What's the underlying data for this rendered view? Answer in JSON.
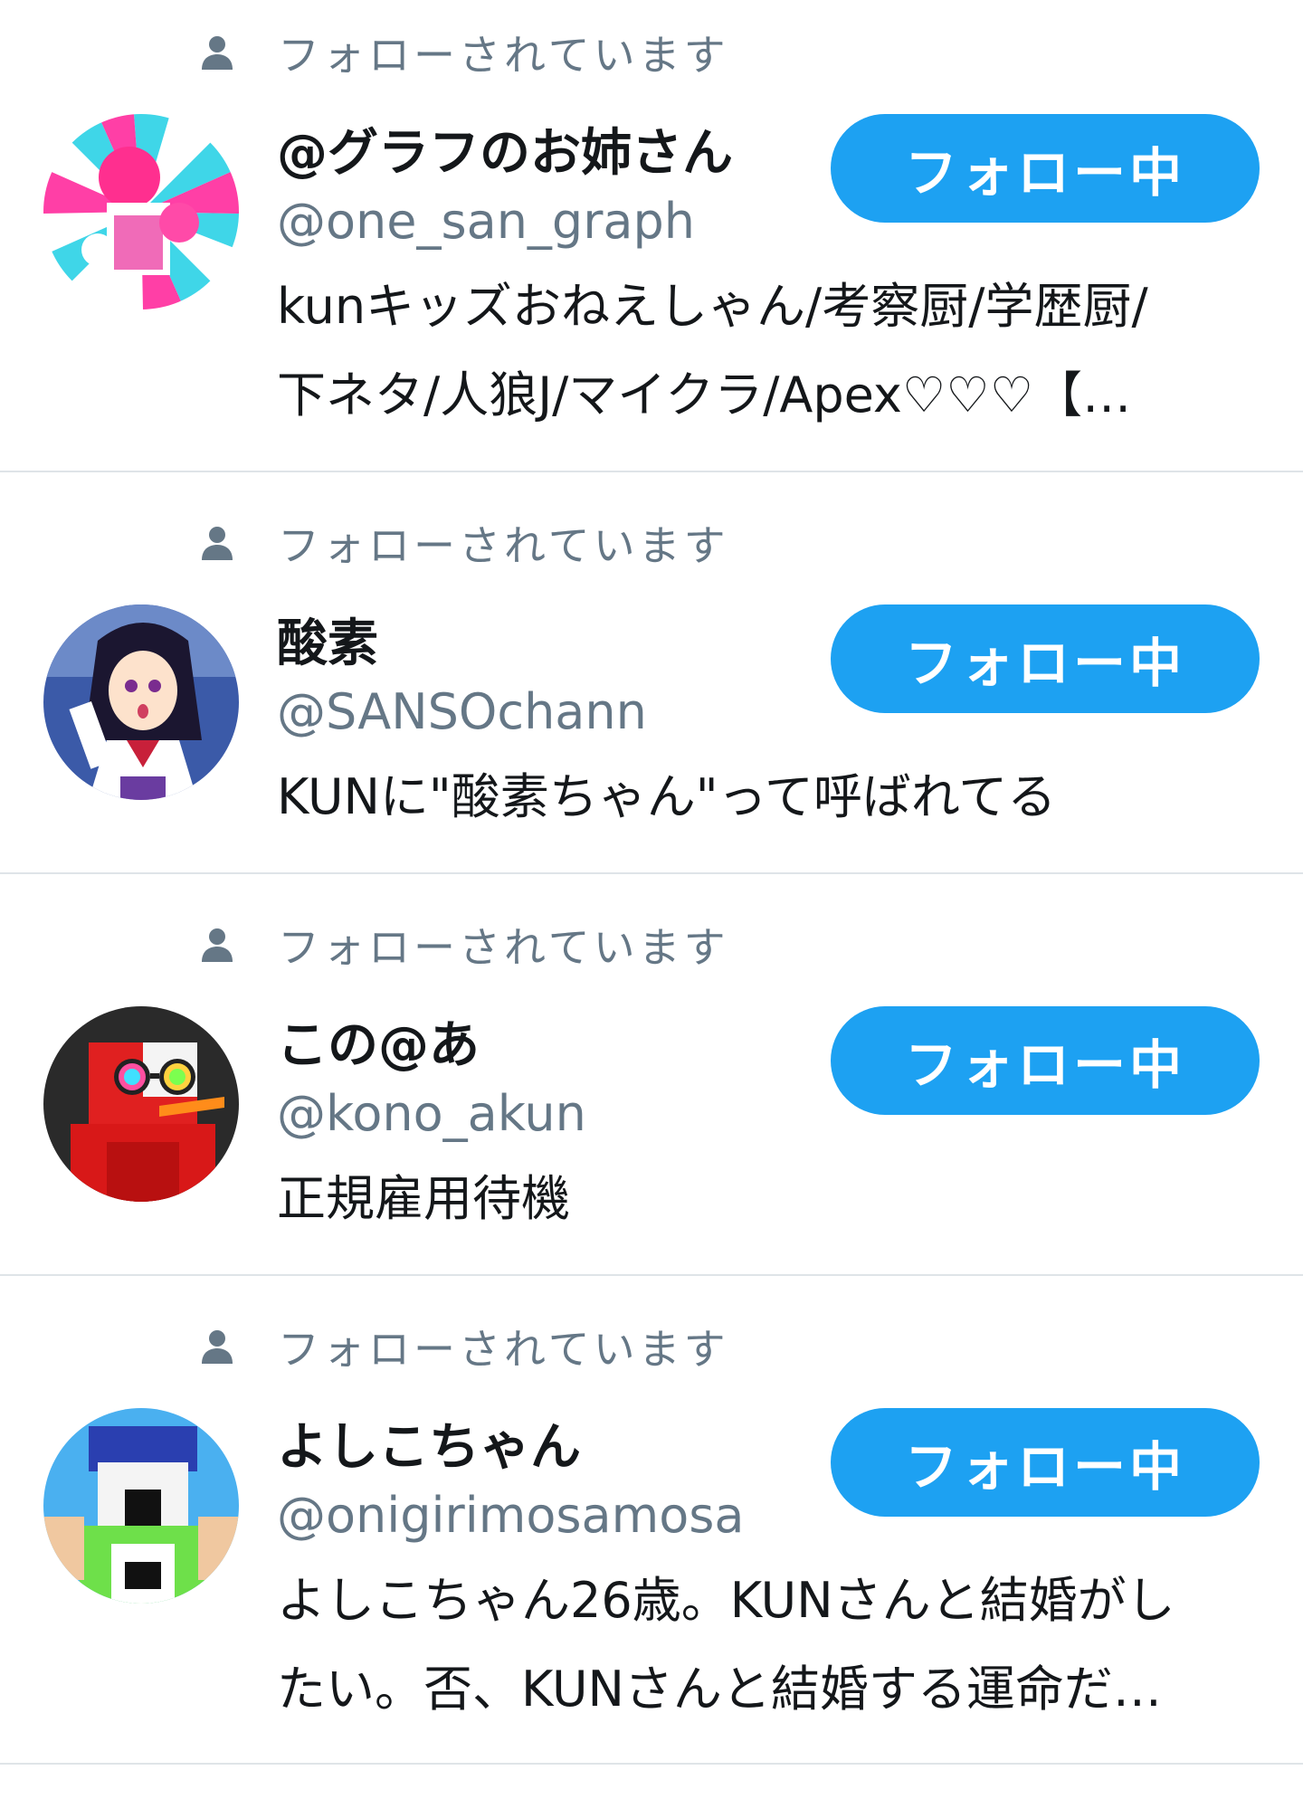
{
  "followed_label": "フォローされています",
  "follow_button_label": "フォロー中",
  "colors": {
    "accent": "#1da1f2",
    "secondary_text": "#657786",
    "primary_text": "#14171a",
    "divider": "#dfe4e8"
  },
  "users": [
    {
      "name": "@グラフのお姉さん",
      "handle": "@one_san_graph",
      "bio_lines": [
        "kunキッズおねえしゃん/考察厨/学歴厨/",
        "下ネタ/人狼J/マイクラ/Apex♡♡♡【…"
      ]
    },
    {
      "name": "酸素",
      "handle": "@SANSOchann",
      "bio_lines": [
        "KUNに\"酸素ちゃん\"って呼ばれてる"
      ]
    },
    {
      "name": "この@あ",
      "handle": "@kono_akun",
      "bio_lines": [
        "正規雇用待機"
      ]
    },
    {
      "name": "よしこちゃん",
      "handle": "@onigirimosamosa",
      "bio_lines": [
        "よしこちゃん26歳。KUNさんと結婚がし",
        "たい。否、KUNさんと結婚する運命だ…"
      ]
    }
  ]
}
